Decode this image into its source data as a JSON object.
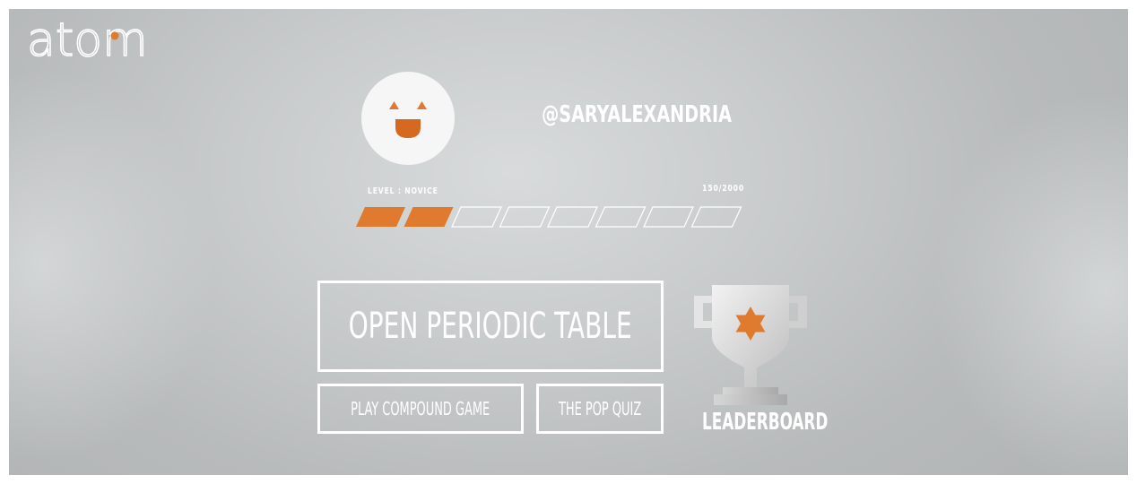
{
  "app": {
    "logo_text": "atom"
  },
  "profile": {
    "username": "@SARYALEXANDRIA",
    "avatar_icon": "smiley-face-icon"
  },
  "level": {
    "label": "LEVEL : NOVICE",
    "score_text": "150/2000",
    "segments_total": 8,
    "segments_filled": 2
  },
  "menu": {
    "open_table": "OPEN PERIODIC TABLE",
    "compound_game": "PLAY COMPOUND GAME",
    "pop_quiz": "THE POP QUIZ",
    "leaderboard": "LEADERBOARD"
  },
  "icons": {
    "leaderboard": "trophy-star-icon",
    "logo_dot": "orange-dot"
  },
  "colors": {
    "accent": "#e07a2f",
    "text": "#ffffff",
    "trophy_silver": "#dedede",
    "background": "#c6c9ca"
  }
}
